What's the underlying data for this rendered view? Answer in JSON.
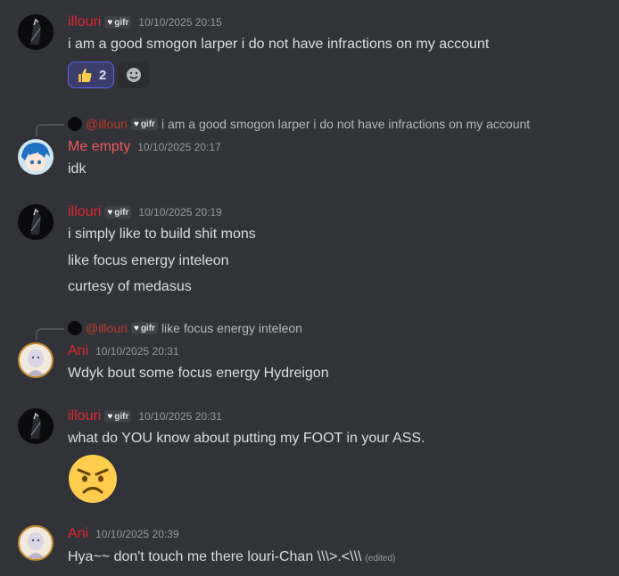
{
  "colors": {
    "background": "#313338",
    "illouri": "#e0262d",
    "me_empty": "#f05a5f",
    "ani": "#e0262d",
    "reply_mention": "#c0392b"
  },
  "server_tag": {
    "icon": "heart-icon",
    "text": "gifr"
  },
  "messages": [
    {
      "author": "illouri",
      "timestamp": "10/10/2025 20:15",
      "lines": [
        "i am a good smogon larper i do not have infractions on my account"
      ],
      "reactions": [
        {
          "emoji": "thumbs-up-icon",
          "count": "2"
        }
      ]
    },
    {
      "author": "Me empty",
      "timestamp": "10/10/2025 20:17",
      "reply": {
        "author": "@illouri",
        "text": "i am a good smogon larper i do not have infractions on my account"
      },
      "lines": [
        "idk"
      ]
    },
    {
      "author": "illouri",
      "timestamp": "10/10/2025 20:19",
      "lines": [
        "i simply like to build shit mons",
        "like focus energy inteleon",
        "curtesy of medasus"
      ]
    },
    {
      "author": "Ani",
      "timestamp": "10/10/2025 20:31",
      "reply": {
        "author": "@illouri",
        "text": "like focus energy inteleon"
      },
      "lines": [
        "Wdyk bout some focus energy Hydreigon"
      ]
    },
    {
      "author": "illouri",
      "timestamp": "10/10/2025 20:31",
      "lines": [
        "what do YOU know about putting my FOOT in your ASS."
      ],
      "emoji": "angry-face-icon"
    },
    {
      "author": "Ani",
      "timestamp": "10/10/2025 20:39",
      "lines": [
        "Hya~~ don't touch me there louri-Chan \\\\\\>.<\\\\\\"
      ],
      "edited_label": "(edited)"
    }
  ]
}
